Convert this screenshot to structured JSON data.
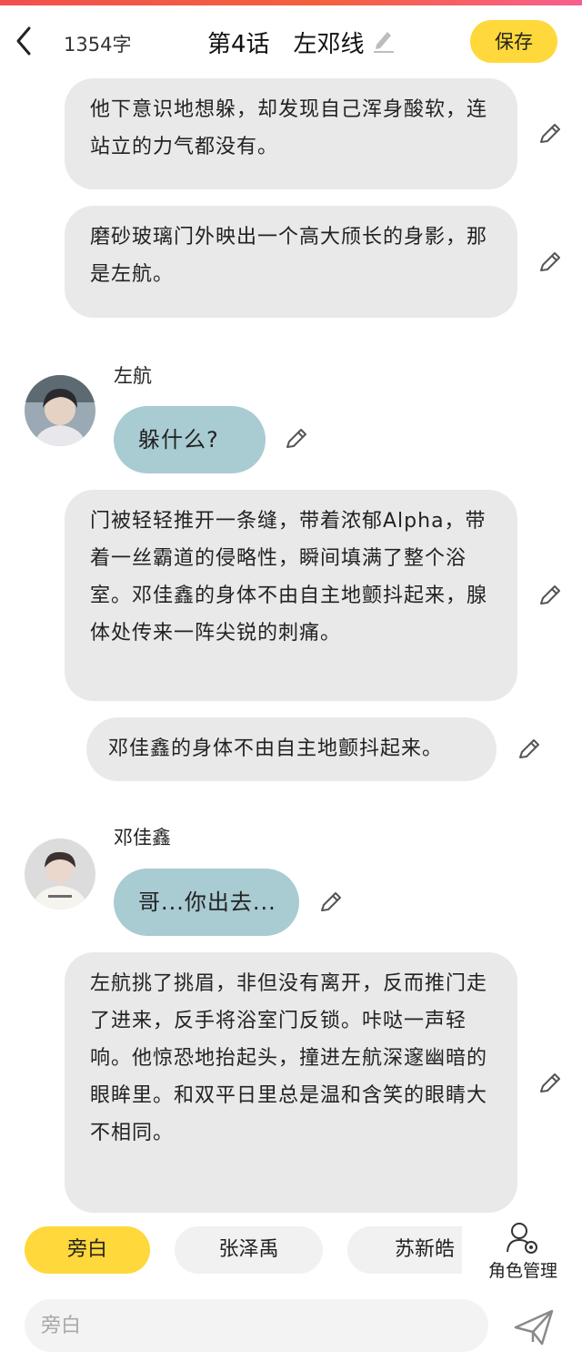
{
  "header": {
    "word_count": "1354字",
    "title": "第4话　左邓线",
    "save_label": "保存"
  },
  "messages": {
    "n1": "他下意识地想躲，却发现自己浑身酸软，连站立的力气都没有。",
    "n2": "磨砂玻璃门外映出一个高大颀长的身影，那是左航。",
    "d1_name": "左航",
    "d1_text": "躲什么?",
    "n3": "门被轻轻推开一条缝，带着浓郁Alpha，带着一丝霸道的侵略性，瞬间填满了整个浴室。邓佳鑫的身体不由自主地颤抖起来，腺体处传来一阵尖锐的刺痛。",
    "n4": "邓佳鑫的身体不由自主地颤抖起来。",
    "d2_name": "邓佳鑫",
    "d2_text": "哥...你出去...",
    "n5": "左航挑了挑眉，非但没有离开，反而推门走了进来，反手将浴室门反锁。咔哒一声轻响。他惊恐地抬起头，撞进左航深邃幽暗的眼眸里。和双平日里总是温和含笑的眼睛大不相同。"
  },
  "roles": {
    "narration": "旁白",
    "role1": "张泽禹",
    "role2": "苏新皓",
    "manage": "角色管理"
  },
  "composer": {
    "placeholder": "旁白"
  },
  "icons": {
    "back": "chevron-left-icon",
    "title_edit": "pencil-icon",
    "edit": "pencil-icon",
    "manage": "user-gear-icon",
    "send": "paper-plane-icon"
  },
  "colors": {
    "accent": "#ffd83b",
    "dialogue_bubble": "#a9cbd2",
    "narration_bubble": "#e9e9e9"
  }
}
